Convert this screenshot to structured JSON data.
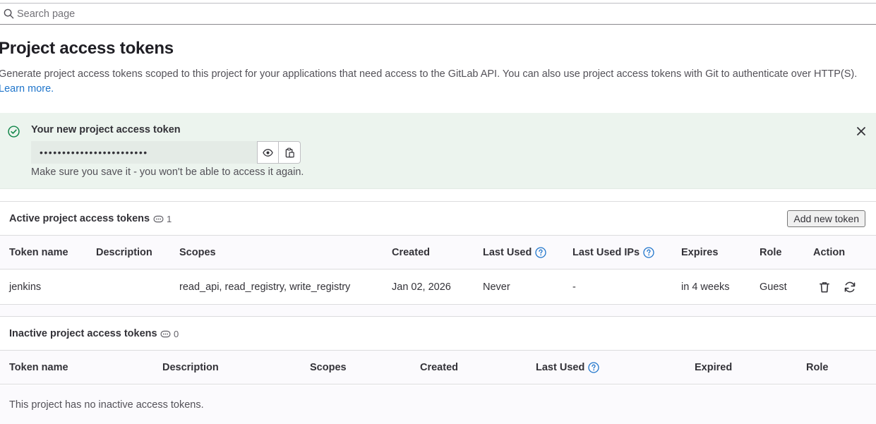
{
  "search": {
    "placeholder": "Search page"
  },
  "page": {
    "title": "Project access tokens",
    "description": "Generate project access tokens scoped to this project for your applications that need access to the GitLab API. You can also use project access tokens with Git to authenticate over HTTP(S). ",
    "learn_more": "Learn more."
  },
  "alert": {
    "title": "Your new project access token",
    "token_masked": "••••••••••••••••••••••••",
    "note": "Make sure you save it - you won't be able to access it again."
  },
  "active": {
    "title": "Active project access tokens",
    "count": "1",
    "add_button": "Add new token",
    "columns": {
      "name": "Token name",
      "description": "Description",
      "scopes": "Scopes",
      "created": "Created",
      "last_used": "Last Used",
      "last_used_ips": "Last Used IPs",
      "expires": "Expires",
      "role": "Role",
      "action": "Action"
    },
    "rows": [
      {
        "name": "jenkins",
        "description": "",
        "scopes": "read_api, read_registry, write_registry",
        "created": "Jan 02, 2026",
        "last_used": "Never",
        "last_used_ips": "-",
        "expires": "in 4 weeks",
        "role": "Guest"
      }
    ]
  },
  "inactive": {
    "title": "Inactive project access tokens",
    "count": "0",
    "columns": {
      "name": "Token name",
      "description": "Description",
      "scopes": "Scopes",
      "created": "Created",
      "last_used": "Last Used",
      "expired": "Expired",
      "role": "Role"
    },
    "empty_text": "This project has no inactive access tokens."
  },
  "colors": {
    "link": "#1f75cb",
    "success": "#108548",
    "alert_bg": "#ecf4ee"
  }
}
